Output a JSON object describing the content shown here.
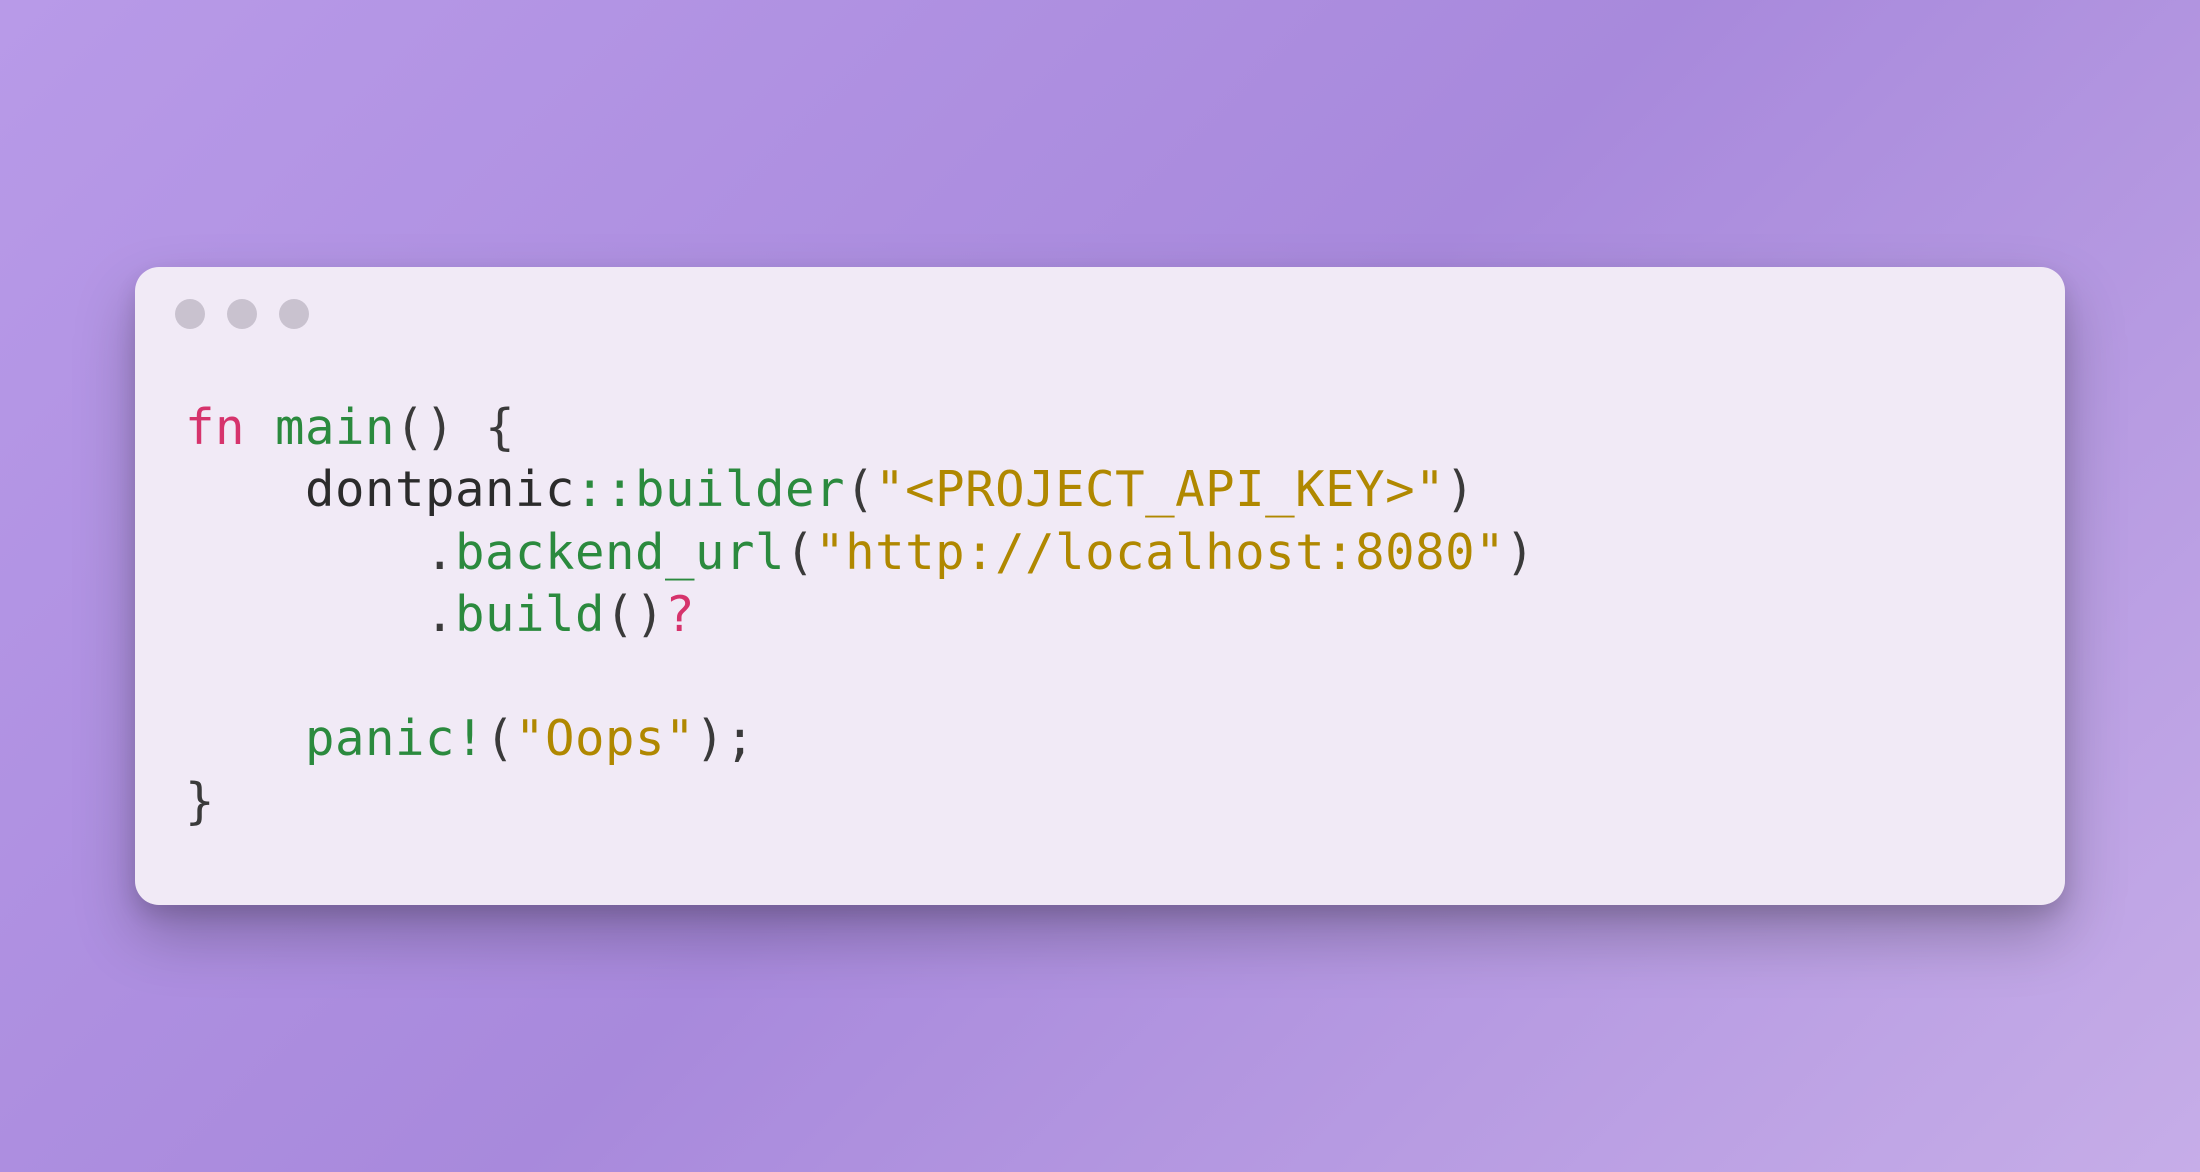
{
  "code": {
    "line1": {
      "kw_fn": "fn",
      "fn_name": "main",
      "parens": "()",
      "open_brace": " {"
    },
    "line2": {
      "indent": "    ",
      "module": "dontpanic",
      "op": "::",
      "method": "builder",
      "open_paren": "(",
      "string": "\"<PROJECT_API_KEY>\"",
      "close_paren": ")"
    },
    "line3": {
      "indent": "        ",
      "dot": ".",
      "method": "backend_url",
      "open_paren": "(",
      "string": "\"http://localhost:8080\"",
      "close_paren": ")"
    },
    "line4": {
      "indent": "        ",
      "dot": ".",
      "method": "build",
      "parens": "()",
      "qmark": "?"
    },
    "line5": "",
    "line6": {
      "indent": "    ",
      "macro": "panic!",
      "open_paren": "(",
      "string": "\"Oops\"",
      "close_paren": ")",
      "semi": ";"
    },
    "line7": {
      "close_brace": "}"
    }
  }
}
